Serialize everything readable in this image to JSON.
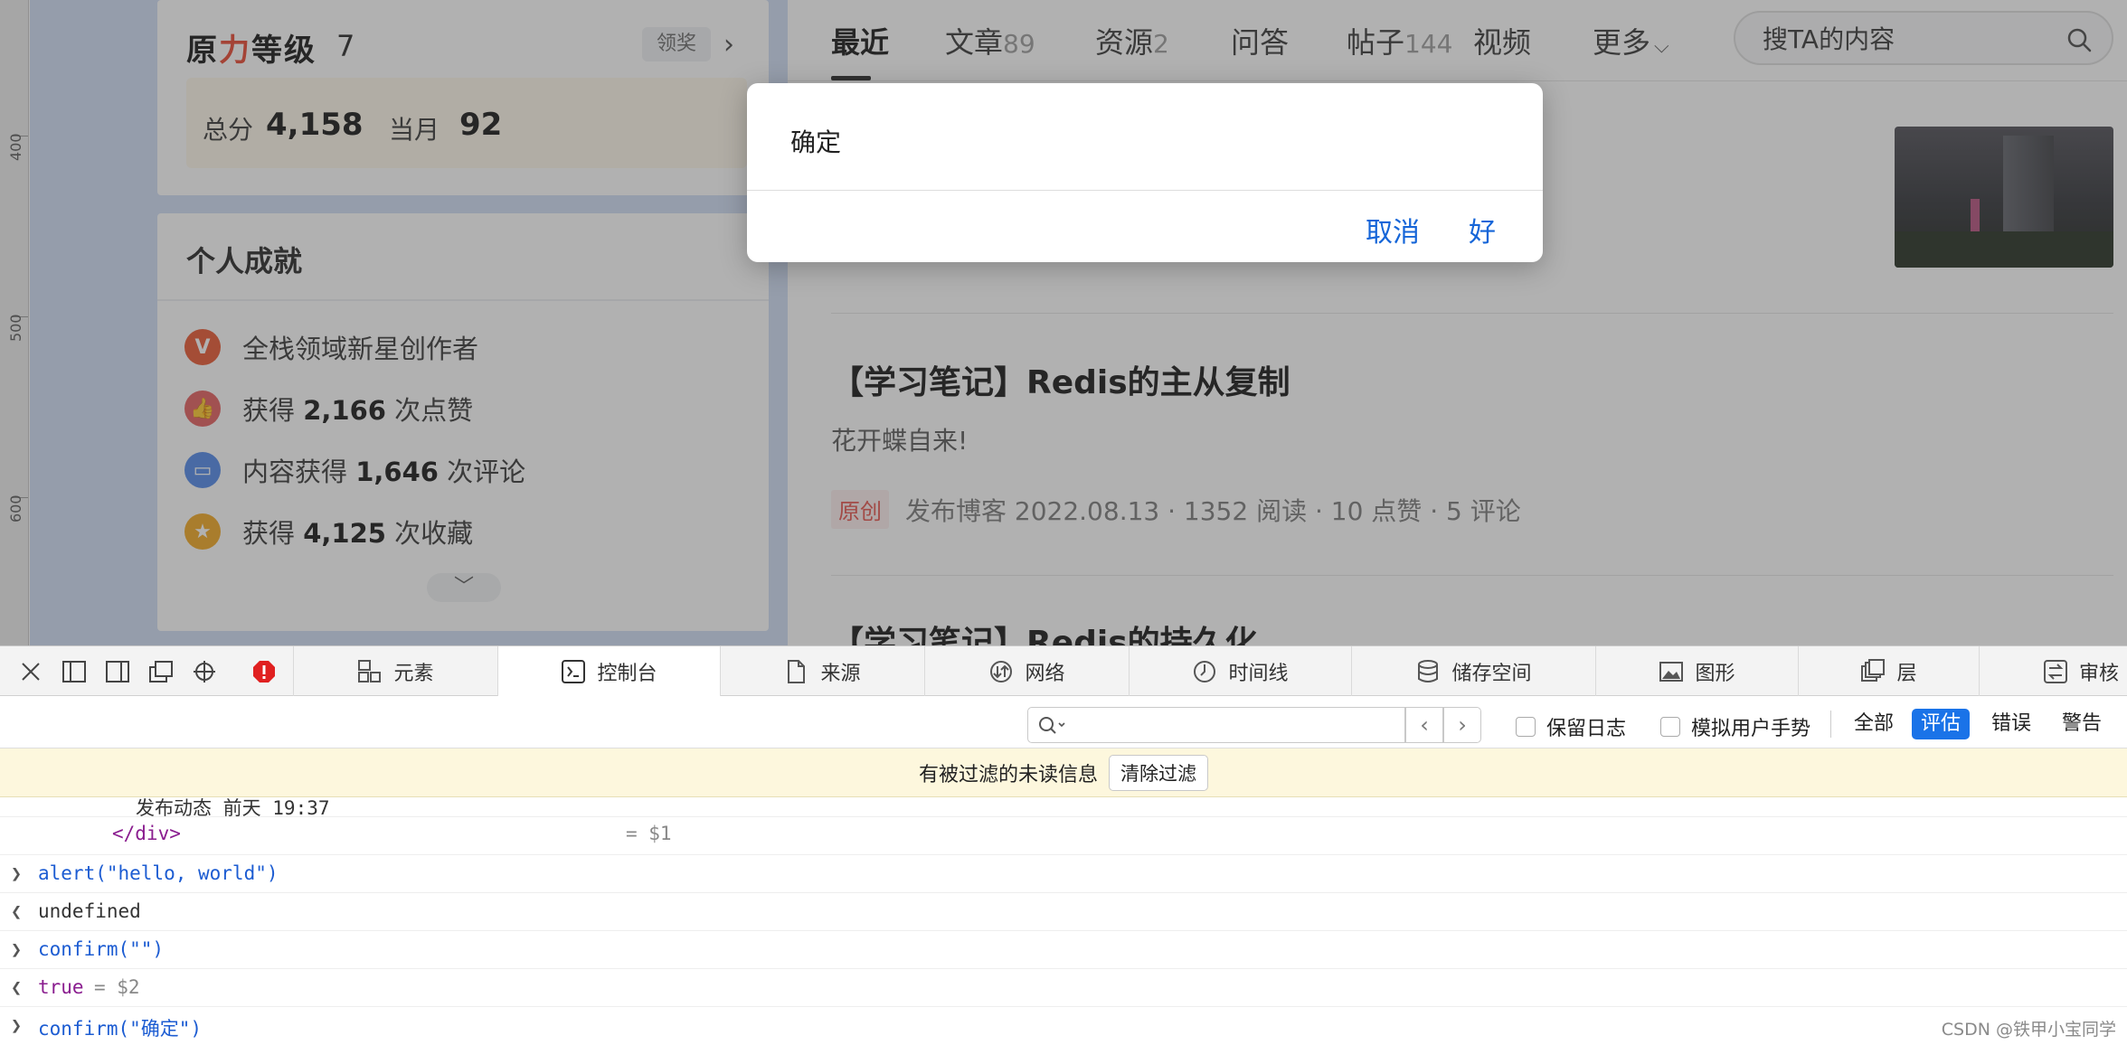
{
  "ruler": {
    "marks": [
      "400",
      "500",
      "600"
    ]
  },
  "level_card": {
    "title_prefix": "原",
    "title_red": "力",
    "title_suffix": "等级",
    "level": "7",
    "reward_label": "领奖",
    "total_label": "总分",
    "total_value": "4,158",
    "month_label": "当月",
    "month_value": "92"
  },
  "achievements": {
    "title": "个人成就",
    "items": [
      {
        "icon": "v-badge-icon",
        "color": "#e8532c",
        "pre": "全栈领域新星创作者",
        "num": "",
        "post": ""
      },
      {
        "icon": "thumb-up-badge-icon",
        "color": "#e35a5a",
        "pre": "获得 ",
        "num": "2,166",
        "post": " 次点赞"
      },
      {
        "icon": "comment-badge-icon",
        "color": "#4d86e8",
        "pre": "内容获得 ",
        "num": "1,646",
        "post": " 次评论"
      },
      {
        "icon": "star-badge-icon",
        "color": "#f1a51c",
        "pre": "获得 ",
        "num": "4,125",
        "post": " 次收藏"
      }
    ]
  },
  "tabs": [
    {
      "label": "最近",
      "count": ""
    },
    {
      "label": "文章",
      "count": "89"
    },
    {
      "label": "资源",
      "count": "2"
    },
    {
      "label": "问答",
      "count": ""
    },
    {
      "label": "帖子",
      "count": "144"
    },
    {
      "label": "视频",
      "count": ""
    },
    {
      "label": "更多",
      "count": ""
    }
  ],
  "search": {
    "placeholder": "搜TA的内容"
  },
  "posts": [
    {
      "title": "【学习笔记】Redis的主从复制",
      "desc": "花开蝶自来!",
      "badge": "原创",
      "meta": "发布博客 2022.08.13 · 1352 阅读 · 10 点赞 · 5 评论"
    },
    {
      "title": "【学习笔记】Redis的持久化"
    }
  ],
  "dialog": {
    "message": "确定",
    "cancel": "取消",
    "ok": "好"
  },
  "devtools": {
    "tabs": [
      {
        "label": "元素",
        "icon": "elements-icon"
      },
      {
        "label": "控制台",
        "icon": "console-icon"
      },
      {
        "label": "来源",
        "icon": "sources-icon"
      },
      {
        "label": "网络",
        "icon": "network-icon"
      },
      {
        "label": "时间线",
        "icon": "timeline-icon"
      },
      {
        "label": "储存空间",
        "icon": "storage-icon"
      },
      {
        "label": "图形",
        "icon": "graphics-icon"
      },
      {
        "label": "层",
        "icon": "layers-icon"
      },
      {
        "label": "审核",
        "icon": "audit-icon"
      }
    ],
    "filter": {
      "preserve_log": "保留日志",
      "simulate_gesture": "模拟用户手势",
      "levels": [
        "全部",
        "评估",
        "错误",
        "警告"
      ],
      "active_level": "评估"
    },
    "banner": {
      "text": "有被过滤的未读信息",
      "clear": "清除过滤"
    },
    "console": {
      "partial_line": "发布动态 前天 19:37",
      "close_tag": "</div>",
      "close_tag_ref": "= $1",
      "entries": [
        {
          "kind": "input",
          "text": "alert(\"hello, world\")"
        },
        {
          "kind": "output",
          "text": "undefined"
        },
        {
          "kind": "input",
          "text": "confirm(\"\")"
        },
        {
          "kind": "output",
          "text": "true",
          "ref": "= $2"
        },
        {
          "kind": "input",
          "text": "confirm(\"确定\")"
        }
      ]
    }
  },
  "watermark": "CSDN @铁甲小宝同学"
}
